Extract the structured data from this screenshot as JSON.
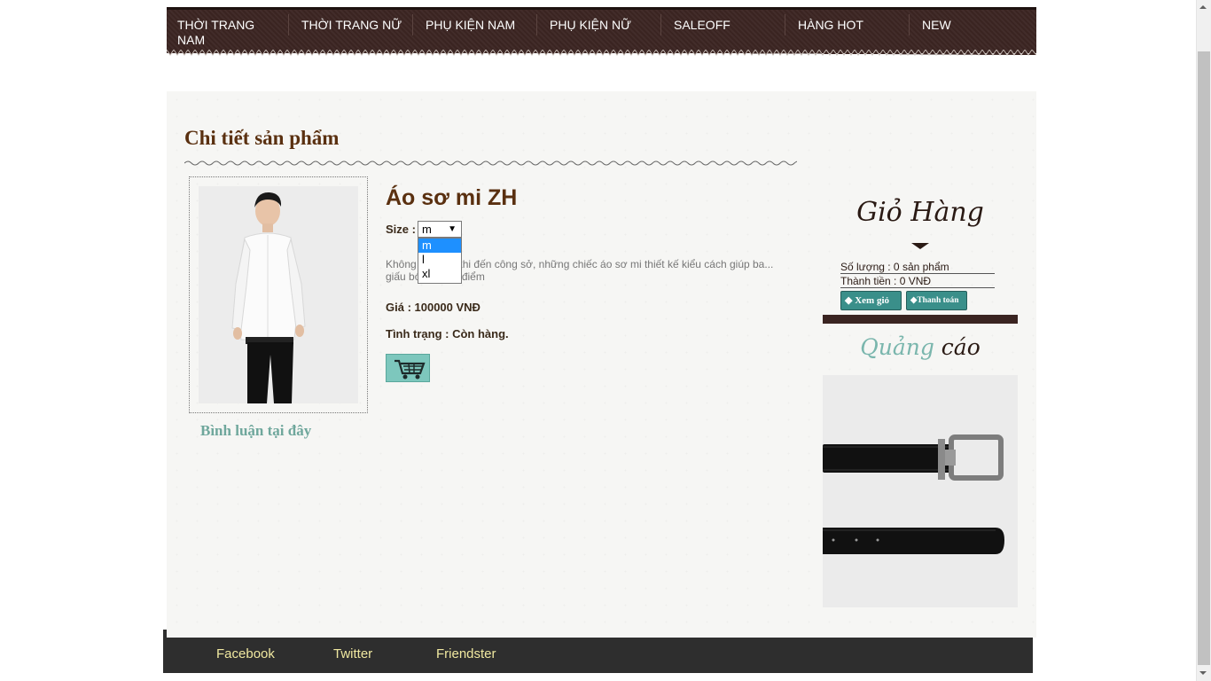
{
  "nav": {
    "items": [
      "THỜI TRANG NAM",
      "THỜI TRANG NỮ",
      "PHỤ KIỆN NAM",
      "PHỤ KIỆN NỮ",
      "SALEOFF",
      "HÀNG HOT",
      "NEW"
    ]
  },
  "main": {
    "page_title": "Chi tiết sản phẩm",
    "comment_link": "Bình luận tại đây"
  },
  "product": {
    "name": "Áo sơ mi ZH",
    "size_label": "Size :",
    "size_selected": "m",
    "size_options": [
      "m",
      "l",
      "xl"
    ],
    "description": "Không ... nhắc khi đến công sở, những chiếc áo sơ mi thiết kế kiểu cách giúp ba... giấu bớt nhược điểm",
    "price": "Giá : 100000 VNĐ",
    "status": "Tình trạng : Còn hàng."
  },
  "cart": {
    "title": "Giỏ Hàng",
    "quantity": "Số lượng : 0 sản phẩm",
    "total": "Thành tiền : 0 VNĐ",
    "view_button": "Xem giỏ",
    "checkout_button": "Thanh toán"
  },
  "ads": {
    "title_part1": "Quảng",
    "title_part2": "cáo"
  },
  "footer": {
    "links": [
      "Facebook",
      "Twitter",
      "Friendster"
    ]
  },
  "colors": {
    "nav_bg": "#3a2421",
    "title_brown": "#5a3010",
    "accent_teal": "#7ab6ad",
    "footer_bg": "#2e2e2e",
    "footer_link": "#f0e8a0"
  }
}
